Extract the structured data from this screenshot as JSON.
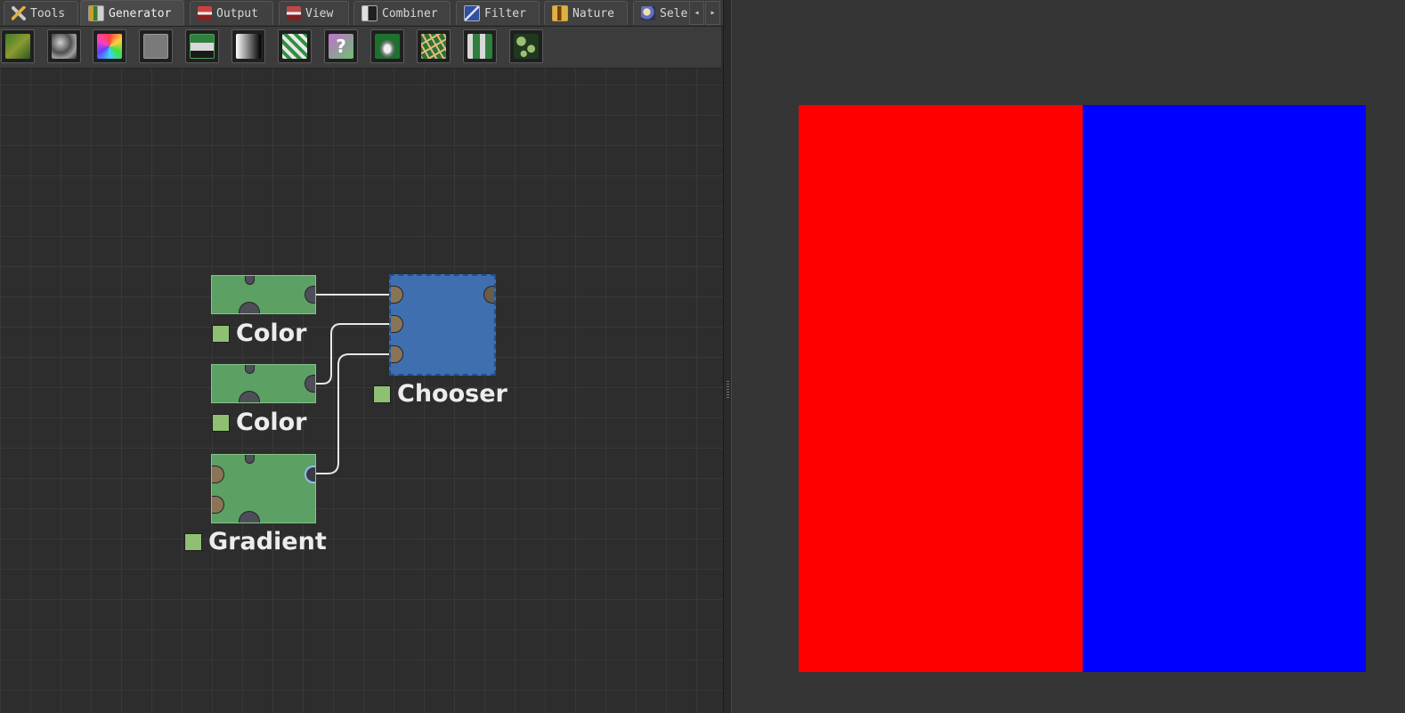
{
  "tabs": [
    {
      "label": "Tools",
      "icon": "tools-icon",
      "active": false
    },
    {
      "label": "Generator",
      "icon": "generator-icon",
      "active": true
    },
    {
      "label": "Output",
      "icon": "output-icon",
      "active": false
    },
    {
      "label": "View",
      "icon": "view-icon",
      "active": false
    },
    {
      "label": "Combiner",
      "icon": "combiner-icon",
      "active": false
    },
    {
      "label": "Filter",
      "icon": "filter-icon",
      "active": false
    },
    {
      "label": "Nature",
      "icon": "nature-icon",
      "active": false
    },
    {
      "label": "Sele",
      "icon": "select-icon",
      "active": false
    }
  ],
  "tab_scroll": {
    "left": "◂",
    "right": "▸"
  },
  "toolbar_tools": [
    "terrain-generator-icon",
    "noise-generator-icon",
    "rainbow-color-icon",
    "solid-color-icon",
    "save-file-icon",
    "gradient-icon",
    "checker-pattern-icon",
    "help-question-icon",
    "bump-sphere-icon",
    "crackle-pattern-icon",
    "tile-grid-icon",
    "cell-pattern-icon"
  ],
  "nodes": {
    "color1": {
      "label": "Color"
    },
    "color2": {
      "label": "Color"
    },
    "gradient": {
      "label": "Gradient"
    },
    "chooser": {
      "label": "Chooser"
    }
  },
  "colors": {
    "node_green": "#5ca064",
    "node_blue": "#3f6fae",
    "chip_green": "#8fbf73",
    "wire": "#e8e8e8",
    "preview_left": "#ff0000",
    "preview_right": "#0000ff"
  }
}
